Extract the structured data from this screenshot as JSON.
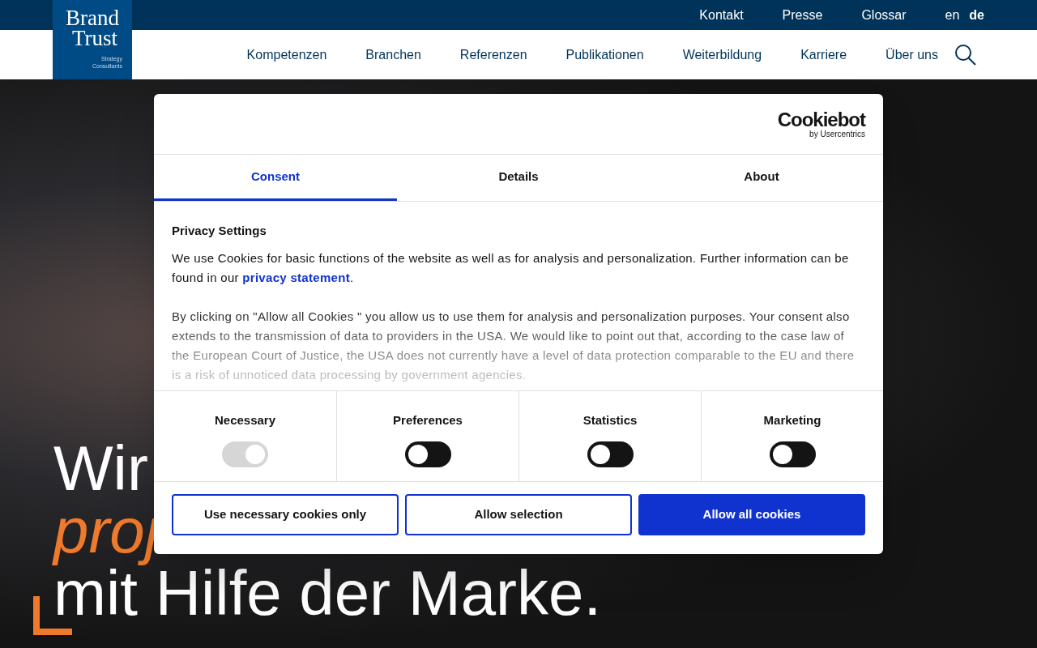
{
  "logo": {
    "line_1": "Brand",
    "line_2": "Trust",
    "tagline_1": "Strategy",
    "tagline_2": "Consultants"
  },
  "top_links": [
    "Kontakt",
    "Presse",
    "Glossar"
  ],
  "languages": [
    {
      "label": "en",
      "selected": false
    },
    {
      "label": "de",
      "selected": true
    }
  ],
  "main_nav": [
    "Kompetenzen",
    "Branchen",
    "Referenzen",
    "Publikationen",
    "Weiterbildung",
    "Karriere",
    "Über uns"
  ],
  "hero": {
    "line_1": "Wir",
    "line_2": "proj",
    "line_3": "mit Hilfe der Marke."
  },
  "cookie_dialog": {
    "brand": "Cookiebot",
    "brand_sub": "by Usercentrics",
    "tabs": [
      {
        "label": "Consent",
        "selected": true
      },
      {
        "label": "Details",
        "selected": false
      },
      {
        "label": "About",
        "selected": false
      }
    ],
    "heading": "Privacy Settings",
    "paragraph_1": "We use Cookies for basic functions of the website as well as for analysis and personalization. Further information can be found in our ",
    "link": "privacy statement",
    "paragraph_1_end": ".",
    "paragraph_2": "By clicking on \"Allow all Cookies \" you allow us to use them for analysis and personalization purposes. Your consent also extends to the transmission of data to providers in the USA. We would like to point out that, according to the case law of the European Court of Justice, the USA does not currently have a level of data protection comparable to the EU and there is a risk of unnoticed data processing by government agencies.",
    "categories": [
      {
        "label": "Necessary",
        "checked": true,
        "disabled": true
      },
      {
        "label": "Preferences",
        "checked": false,
        "disabled": false
      },
      {
        "label": "Statistics",
        "checked": false,
        "disabled": false
      },
      {
        "label": "Marketing",
        "checked": false,
        "disabled": false
      }
    ],
    "buttons": [
      {
        "label": "Use necessary cookies only",
        "kind": "outline"
      },
      {
        "label": "Allow selection",
        "kind": "outline"
      },
      {
        "label": "Allow all cookies",
        "kind": "primary"
      }
    ]
  }
}
